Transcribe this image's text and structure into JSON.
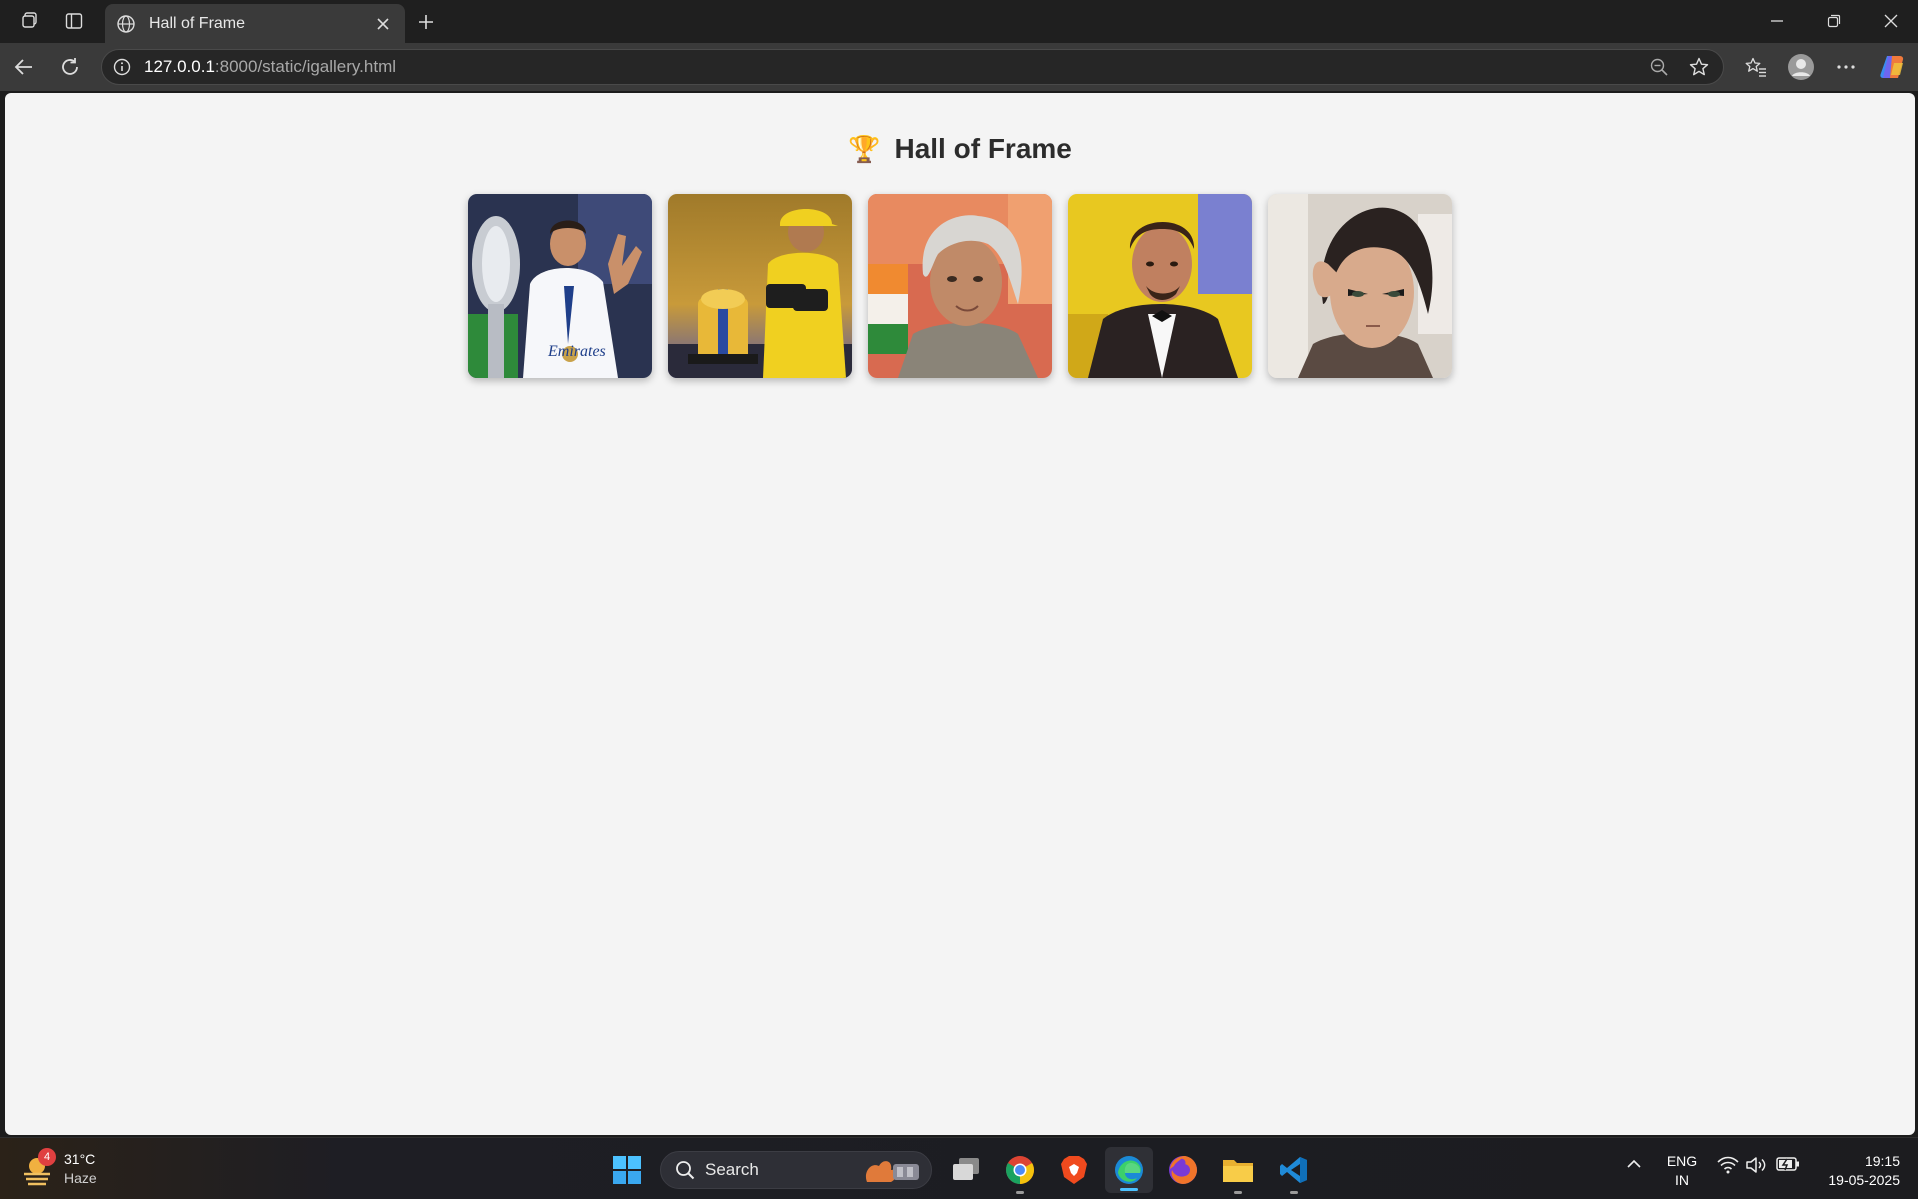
{
  "browser": {
    "tab": {
      "title": "Hall of Frame"
    },
    "address": {
      "host": "127.0.0.1",
      "path": ":8000/static/igallery.html"
    }
  },
  "page": {
    "heading": "Hall of Frame",
    "heading_icon": "🏆",
    "gallery": [
      {
        "name": "gallery-image-footballer-trophy"
      },
      {
        "name": "gallery-image-cricketer-trophy"
      },
      {
        "name": "gallery-image-elder-statesman"
      },
      {
        "name": "gallery-image-man-in-tuxedo"
      },
      {
        "name": "gallery-image-anime-character"
      }
    ]
  },
  "taskbar": {
    "weather": {
      "temp": "31°C",
      "condition": "Haze",
      "badge": "4"
    },
    "search_placeholder": "Search",
    "language": {
      "line1": "ENG",
      "line2": "IN"
    },
    "clock": {
      "time": "19:15",
      "date": "19-05-2025"
    }
  },
  "colors": {
    "page_bg": "#f4f4f4",
    "chrome_dark": "#1f1f1f",
    "toolbar": "#3a3a3a",
    "accent": "#4cc2ff"
  }
}
